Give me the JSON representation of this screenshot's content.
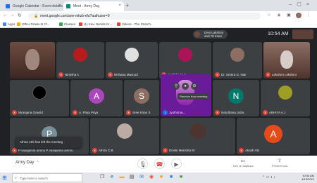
{
  "browser": {
    "tabs": [
      {
        "title": "Google Calendar - Event details",
        "favicon_color": "#1a73e8"
      },
      {
        "title": "Meet - Army Day",
        "favicon_color": "#00897b"
      }
    ],
    "new_tab_icon": "plus-icon",
    "url": "meet.google.com/ane-mkzb-efu?authuser=0",
    "bookmarks": [
      {
        "label": "Apps",
        "icon_color": "#4285f4"
      },
      {
        "label": "Other Grade-III Cl...",
        "icon_color": "#f9ab00"
      },
      {
        "label": "Classes",
        "icon_color": "#34a853"
      },
      {
        "label": "(1) Kavi Nandis Kr...",
        "icon_color": "#ea4335"
      },
      {
        "label": "Videos - The Stretch...",
        "icon_color": "#ea4335"
      }
    ]
  },
  "meet": {
    "presenter": {
      "name": "Devi Lakshmi",
      "subtitle": "and 78 more"
    },
    "clock": "10:54 AM",
    "participants": [
      {
        "name": "",
        "kind": "video",
        "scene": "#5d4037"
      },
      {
        "name": "Nimisha s",
        "kind": "photo",
        "avatar": "#b71c1c"
      },
      {
        "name": "Nishana Masood",
        "kind": "photo",
        "avatar": "#e0e0e0"
      },
      {
        "name": "Karthika M.S",
        "kind": "photo",
        "avatar": "#ad1457"
      },
      {
        "name": "Dr. Smera G. Nair",
        "kind": "photo",
        "avatar": "#8d6e63"
      },
      {
        "name": "Lekshmi Lekshmi",
        "kind": "video",
        "scene": "#6d4c41"
      },
      {
        "name": "Niranjana Gowrid",
        "kind": "photo",
        "avatar": "#000000"
      },
      {
        "name": "A. Priya Priya",
        "kind": "letter",
        "letter": "A",
        "avatar": "#ab47bc"
      },
      {
        "name": "Sree Kiran S",
        "kind": "letter",
        "letter": "S",
        "avatar": "#8d6e63"
      },
      {
        "name": "Jyothirma...",
        "kind": "video",
        "scene": "#ab47bc"
      },
      {
        "name": "Nandhana Usha",
        "kind": "letter",
        "letter": "N",
        "avatar": "#00796b"
      },
      {
        "name": "ABHIYA A.J",
        "kind": "photo",
        "avatar": "#9e9d24"
      },
      {
        "name": "",
        "kind": "letter",
        "letter": "P",
        "avatar": "#78909c"
      },
      {
        "name": "Athira C.B",
        "kind": "photo",
        "avatar": "#bcaaa4"
      },
      {
        "name": "Devlin Merishta M",
        "kind": "photo",
        "avatar": "#4e342e"
      },
      {
        "name": "Akash Abi",
        "kind": "letter",
        "letter": "A",
        "avatar": "#e64a19"
      }
    ],
    "hover_tooltip": "Remove from meeting",
    "toast": "Athira Athi has left the meeting",
    "toast_overlay_name": "P vasajamia ammu P vasajamia ammu"
  },
  "controls": {
    "meeting_title": "Army Day",
    "captions_label": "Turn on captions",
    "present_label": "Present now"
  },
  "taskbar": {
    "search_placeholder": "Type here to search",
    "time": "10:54 AM",
    "date": "4/15/2021",
    "lang": "ENG\nIN"
  }
}
